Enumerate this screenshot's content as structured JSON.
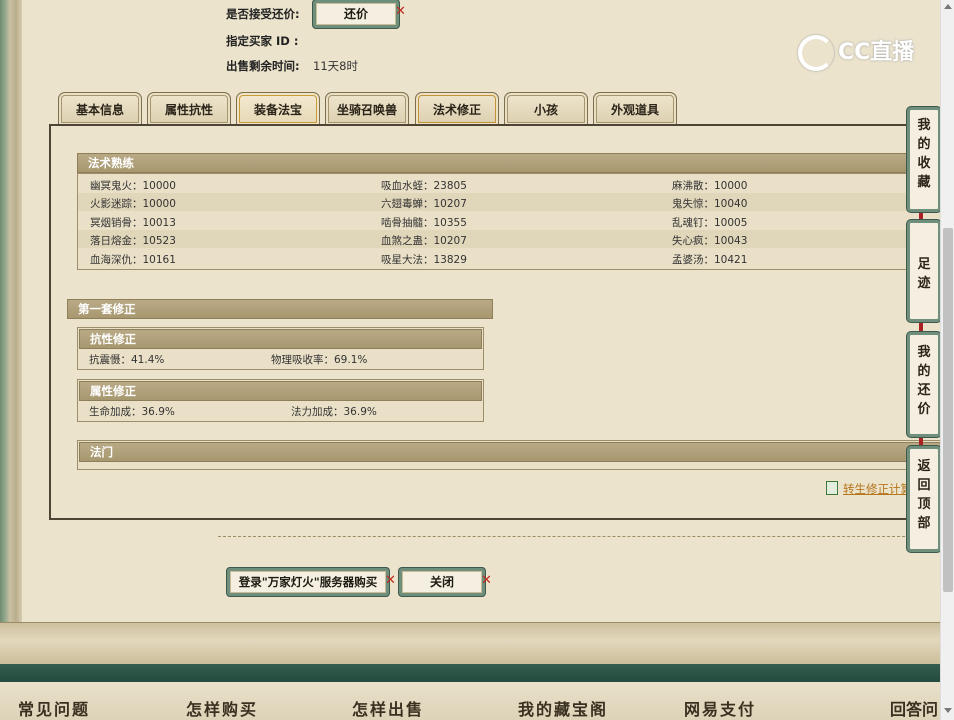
{
  "header": {
    "accept_counter_label": "是否接受还价:",
    "counter_button": "还价",
    "buyer_id_label": "指定买家 ID :",
    "remaining_label": "出售剩余时间:",
    "remaining_value": "11天8时"
  },
  "logo": {
    "text": "CC直播"
  },
  "tabs": [
    {
      "label": "基本信息"
    },
    {
      "label": "属性抗性"
    },
    {
      "label": "装备法宝"
    },
    {
      "label": "坐骑召唤兽"
    },
    {
      "label": "法术修正"
    },
    {
      "label": "小孩"
    },
    {
      "label": "外观道具"
    }
  ],
  "spell_mastery": {
    "title": "法术熟练",
    "rows": [
      [
        "幽冥鬼火：10000",
        "吸血水蛭：23805",
        "麻沸散：10000"
      ],
      [
        "火影迷踪：10000",
        "六翅毒蝉：10207",
        "鬼失惊：10040"
      ],
      [
        "冥烟销骨：10013",
        "啮骨抽髓：10355",
        "乱魂钉：10005"
      ],
      [
        "落日熔金：10523",
        "血煞之蛊：10207",
        "失心疯：10043"
      ],
      [
        "血海深仇：10161",
        "吸星大法：13829",
        "孟婆汤：10421"
      ]
    ]
  },
  "correction": {
    "title": "第一套修正",
    "resist": {
      "title": "抗性修正",
      "items": [
        "抗震慑：41.4%",
        "物理吸收率：69.1%"
      ]
    },
    "attr": {
      "title": "属性修正",
      "items": [
        "生命加成：36.9%",
        "法力加成：36.9%"
      ]
    },
    "magic_title": "法门"
  },
  "calc_link": "转生修正计算",
  "actions": {
    "login_buy": "登录\"万家灯火\"服务器购买",
    "close": "关闭"
  },
  "side_rail": [
    {
      "label": "我的收藏",
      "chars": [
        "我",
        "的",
        "收",
        "藏"
      ]
    },
    {
      "label": "足迹",
      "chars": [
        "足",
        "迹"
      ]
    },
    {
      "label": "我的还价",
      "chars": [
        "我",
        "的",
        "还",
        "价"
      ]
    },
    {
      "label": "返回顶部",
      "chars": [
        "返",
        "回",
        "顶",
        "部"
      ]
    }
  ],
  "footer_nav": [
    "常见问题",
    "怎样购买",
    "怎样出售",
    "我的藏宝阁",
    "网易支付",
    "回答问"
  ],
  "colors": {
    "accent_green": "#6f8e7c",
    "header_bar": "#b9aa86",
    "link": "#b5761c",
    "close_x": "#c0281c"
  }
}
